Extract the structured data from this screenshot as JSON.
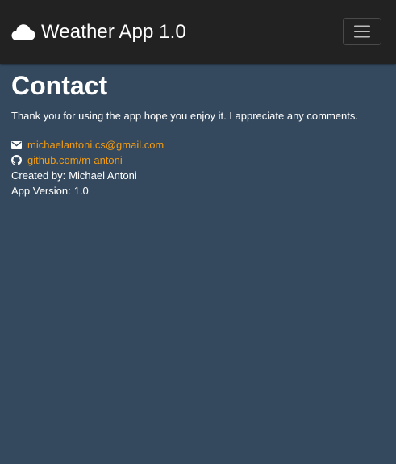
{
  "navbar": {
    "brand": "Weather App 1.0",
    "brand_icon": "cloud-icon",
    "toggler_icon": "hamburger-icon"
  },
  "page": {
    "title": "Contact",
    "lead": "Thank you for using the app hope you enjoy it. I appreciate any comments."
  },
  "contact": {
    "email": "michaelantoni.cs@gmail.com",
    "email_icon": "envelope-icon",
    "github": "github.com/m-antoni",
    "github_icon": "github-icon",
    "created_label": "Created by:",
    "created_value": "Michael Antoni",
    "version_label": "App Version:",
    "version_value": "1.0"
  },
  "colors": {
    "navbar_bg": "#222222",
    "page_bg": "#34495e",
    "link": "#f39c12",
    "text": "#ffffff"
  }
}
